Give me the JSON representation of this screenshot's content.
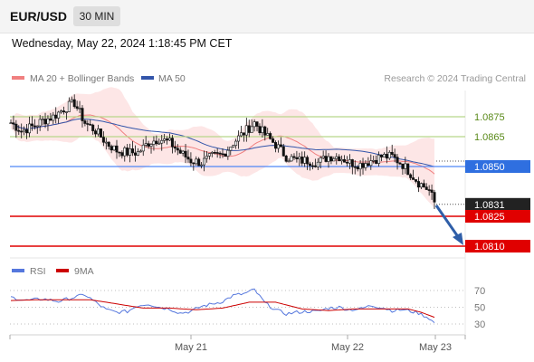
{
  "header": {
    "pair": "EUR/USD",
    "timeframe": "30 MIN",
    "datetime": "Wednesday, May 22, 2024 1:18:45 PM CET"
  },
  "legend": {
    "ma20_label": "MA 20 + Bollinger Bands",
    "ma50_label": "MA 50",
    "copyright": "Research © 2024 Trading Central"
  },
  "rsi_legend": {
    "rsi_label": "RSI",
    "ma_label": "9MA"
  },
  "colors": {
    "ma20": "#f08080",
    "ma50": "#3355aa",
    "band_fill": "#fde0e0",
    "candle": "#111111",
    "resistance_line": "#b8d68a",
    "pivot_line": "#4f86f7",
    "support_line": "#e00000",
    "rsi_line": "#5577dd",
    "rsi_ma": "#cc0000"
  },
  "chart_data": [
    {
      "type": "line",
      "title": "EUR/USD",
      "subtitle": "30 MIN",
      "x_ticks": [
        "May 21",
        "May 22",
        "May 23"
      ],
      "ylim": [
        1.0805,
        1.0905
      ],
      "levels": [
        {
          "value": 1.0875,
          "label": "1.0875",
          "kind": "resistance"
        },
        {
          "value": 1.0865,
          "label": "1.0865",
          "kind": "resistance"
        },
        {
          "value": 1.085,
          "label": "1.0850",
          "kind": "pivot"
        },
        {
          "value": 1.0831,
          "label": "1.0831",
          "kind": "last-price"
        },
        {
          "value": 1.0825,
          "label": "1.0825",
          "kind": "support"
        },
        {
          "value": 1.081,
          "label": "1.0810",
          "kind": "support"
        }
      ],
      "price_path": [
        [
          0,
          1.0872
        ],
        [
          4,
          1.0868
        ],
        [
          8,
          1.087
        ],
        [
          12,
          1.0873
        ],
        [
          16,
          1.0875
        ],
        [
          20,
          1.0879
        ],
        [
          24,
          1.0882
        ],
        [
          28,
          1.0872
        ],
        [
          32,
          1.0868
        ],
        [
          36,
          1.0862
        ],
        [
          40,
          1.0858
        ],
        [
          44,
          1.0857
        ],
        [
          48,
          1.0857
        ],
        [
          52,
          1.0862
        ],
        [
          56,
          1.0864
        ],
        [
          60,
          1.0862
        ],
        [
          64,
          1.0857
        ],
        [
          68,
          1.0853
        ],
        [
          72,
          1.0852
        ],
        [
          76,
          1.0855
        ],
        [
          80,
          1.0856
        ],
        [
          84,
          1.0862
        ],
        [
          88,
          1.0867
        ],
        [
          92,
          1.0872
        ],
        [
          96,
          1.0866
        ],
        [
          100,
          1.0861
        ],
        [
          104,
          1.0855
        ],
        [
          108,
          1.0853
        ],
        [
          112,
          1.0853
        ],
        [
          116,
          1.0852
        ],
        [
          120,
          1.0855
        ],
        [
          124,
          1.0855
        ],
        [
          128,
          1.0852
        ],
        [
          132,
          1.0851
        ],
        [
          136,
          1.0853
        ],
        [
          140,
          1.0855
        ],
        [
          144,
          1.0855
        ],
        [
          148,
          1.0851
        ],
        [
          150,
          1.0848
        ],
        [
          154,
          1.0842
        ],
        [
          158,
          1.0838
        ],
        [
          160,
          1.0832
        ]
      ],
      "rsi": {
        "ylim": [
          20,
          80
        ],
        "ticks": [
          70,
          50,
          30
        ],
        "rsi_values": [
          [
            0,
            62
          ],
          [
            6,
            58
          ],
          [
            12,
            60
          ],
          [
            18,
            57
          ],
          [
            24,
            62
          ],
          [
            28,
            65
          ],
          [
            32,
            56
          ],
          [
            36,
            47
          ],
          [
            40,
            44
          ],
          [
            44,
            45
          ],
          [
            48,
            52
          ],
          [
            52,
            54
          ],
          [
            56,
            50
          ],
          [
            60,
            48
          ],
          [
            64,
            43
          ],
          [
            68,
            45
          ],
          [
            72,
            51
          ],
          [
            76,
            54
          ],
          [
            80,
            57
          ],
          [
            84,
            64
          ],
          [
            88,
            66
          ],
          [
            92,
            71
          ],
          [
            96,
            55
          ],
          [
            100,
            47
          ],
          [
            104,
            42
          ],
          [
            108,
            44
          ],
          [
            112,
            45
          ],
          [
            116,
            45
          ],
          [
            120,
            49
          ],
          [
            124,
            50
          ],
          [
            128,
            47
          ],
          [
            132,
            48
          ],
          [
            136,
            52
          ],
          [
            140,
            50
          ],
          [
            144,
            46
          ],
          [
            148,
            47
          ],
          [
            150,
            46
          ],
          [
            154,
            43
          ],
          [
            158,
            37
          ],
          [
            160,
            31
          ]
        ],
        "ma_values": [
          [
            0,
            58
          ],
          [
            10,
            59
          ],
          [
            20,
            59
          ],
          [
            30,
            59
          ],
          [
            40,
            54
          ],
          [
            50,
            49
          ],
          [
            60,
            49
          ],
          [
            70,
            47
          ],
          [
            80,
            49
          ],
          [
            90,
            56
          ],
          [
            100,
            56
          ],
          [
            110,
            48
          ],
          [
            120,
            46
          ],
          [
            130,
            48
          ],
          [
            140,
            48
          ],
          [
            150,
            48
          ],
          [
            155,
            44
          ],
          [
            160,
            38
          ]
        ]
      }
    }
  ]
}
